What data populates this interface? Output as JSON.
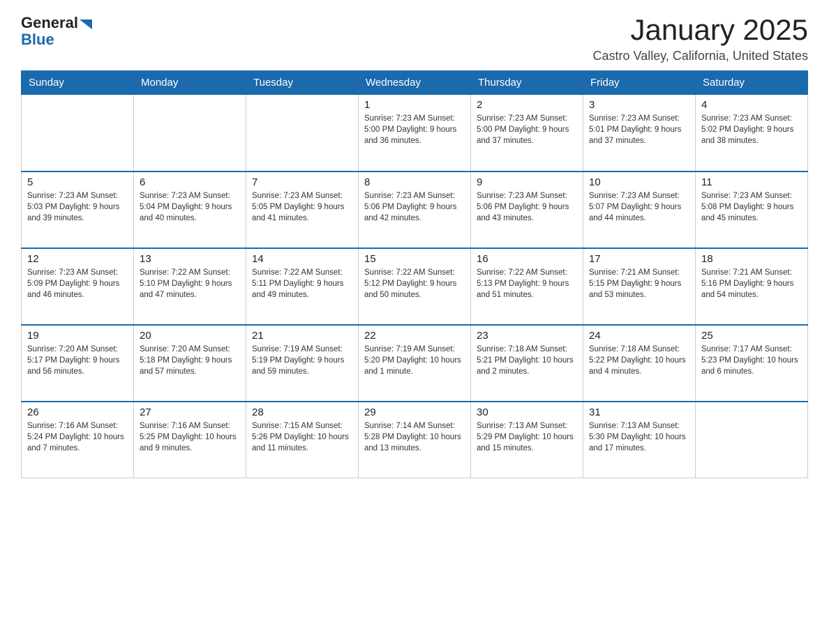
{
  "header": {
    "logo_general": "General",
    "logo_blue": "Blue",
    "month_title": "January 2025",
    "location": "Castro Valley, California, United States"
  },
  "weekdays": [
    "Sunday",
    "Monday",
    "Tuesday",
    "Wednesday",
    "Thursday",
    "Friday",
    "Saturday"
  ],
  "weeks": [
    [
      {
        "day": "",
        "info": ""
      },
      {
        "day": "",
        "info": ""
      },
      {
        "day": "",
        "info": ""
      },
      {
        "day": "1",
        "info": "Sunrise: 7:23 AM\nSunset: 5:00 PM\nDaylight: 9 hours\nand 36 minutes."
      },
      {
        "day": "2",
        "info": "Sunrise: 7:23 AM\nSunset: 5:00 PM\nDaylight: 9 hours\nand 37 minutes."
      },
      {
        "day": "3",
        "info": "Sunrise: 7:23 AM\nSunset: 5:01 PM\nDaylight: 9 hours\nand 37 minutes."
      },
      {
        "day": "4",
        "info": "Sunrise: 7:23 AM\nSunset: 5:02 PM\nDaylight: 9 hours\nand 38 minutes."
      }
    ],
    [
      {
        "day": "5",
        "info": "Sunrise: 7:23 AM\nSunset: 5:03 PM\nDaylight: 9 hours\nand 39 minutes."
      },
      {
        "day": "6",
        "info": "Sunrise: 7:23 AM\nSunset: 5:04 PM\nDaylight: 9 hours\nand 40 minutes."
      },
      {
        "day": "7",
        "info": "Sunrise: 7:23 AM\nSunset: 5:05 PM\nDaylight: 9 hours\nand 41 minutes."
      },
      {
        "day": "8",
        "info": "Sunrise: 7:23 AM\nSunset: 5:06 PM\nDaylight: 9 hours\nand 42 minutes."
      },
      {
        "day": "9",
        "info": "Sunrise: 7:23 AM\nSunset: 5:06 PM\nDaylight: 9 hours\nand 43 minutes."
      },
      {
        "day": "10",
        "info": "Sunrise: 7:23 AM\nSunset: 5:07 PM\nDaylight: 9 hours\nand 44 minutes."
      },
      {
        "day": "11",
        "info": "Sunrise: 7:23 AM\nSunset: 5:08 PM\nDaylight: 9 hours\nand 45 minutes."
      }
    ],
    [
      {
        "day": "12",
        "info": "Sunrise: 7:23 AM\nSunset: 5:09 PM\nDaylight: 9 hours\nand 46 minutes."
      },
      {
        "day": "13",
        "info": "Sunrise: 7:22 AM\nSunset: 5:10 PM\nDaylight: 9 hours\nand 47 minutes."
      },
      {
        "day": "14",
        "info": "Sunrise: 7:22 AM\nSunset: 5:11 PM\nDaylight: 9 hours\nand 49 minutes."
      },
      {
        "day": "15",
        "info": "Sunrise: 7:22 AM\nSunset: 5:12 PM\nDaylight: 9 hours\nand 50 minutes."
      },
      {
        "day": "16",
        "info": "Sunrise: 7:22 AM\nSunset: 5:13 PM\nDaylight: 9 hours\nand 51 minutes."
      },
      {
        "day": "17",
        "info": "Sunrise: 7:21 AM\nSunset: 5:15 PM\nDaylight: 9 hours\nand 53 minutes."
      },
      {
        "day": "18",
        "info": "Sunrise: 7:21 AM\nSunset: 5:16 PM\nDaylight: 9 hours\nand 54 minutes."
      }
    ],
    [
      {
        "day": "19",
        "info": "Sunrise: 7:20 AM\nSunset: 5:17 PM\nDaylight: 9 hours\nand 56 minutes."
      },
      {
        "day": "20",
        "info": "Sunrise: 7:20 AM\nSunset: 5:18 PM\nDaylight: 9 hours\nand 57 minutes."
      },
      {
        "day": "21",
        "info": "Sunrise: 7:19 AM\nSunset: 5:19 PM\nDaylight: 9 hours\nand 59 minutes."
      },
      {
        "day": "22",
        "info": "Sunrise: 7:19 AM\nSunset: 5:20 PM\nDaylight: 10 hours\nand 1 minute."
      },
      {
        "day": "23",
        "info": "Sunrise: 7:18 AM\nSunset: 5:21 PM\nDaylight: 10 hours\nand 2 minutes."
      },
      {
        "day": "24",
        "info": "Sunrise: 7:18 AM\nSunset: 5:22 PM\nDaylight: 10 hours\nand 4 minutes."
      },
      {
        "day": "25",
        "info": "Sunrise: 7:17 AM\nSunset: 5:23 PM\nDaylight: 10 hours\nand 6 minutes."
      }
    ],
    [
      {
        "day": "26",
        "info": "Sunrise: 7:16 AM\nSunset: 5:24 PM\nDaylight: 10 hours\nand 7 minutes."
      },
      {
        "day": "27",
        "info": "Sunrise: 7:16 AM\nSunset: 5:25 PM\nDaylight: 10 hours\nand 9 minutes."
      },
      {
        "day": "28",
        "info": "Sunrise: 7:15 AM\nSunset: 5:26 PM\nDaylight: 10 hours\nand 11 minutes."
      },
      {
        "day": "29",
        "info": "Sunrise: 7:14 AM\nSunset: 5:28 PM\nDaylight: 10 hours\nand 13 minutes."
      },
      {
        "day": "30",
        "info": "Sunrise: 7:13 AM\nSunset: 5:29 PM\nDaylight: 10 hours\nand 15 minutes."
      },
      {
        "day": "31",
        "info": "Sunrise: 7:13 AM\nSunset: 5:30 PM\nDaylight: 10 hours\nand 17 minutes."
      },
      {
        "day": "",
        "info": ""
      }
    ]
  ]
}
